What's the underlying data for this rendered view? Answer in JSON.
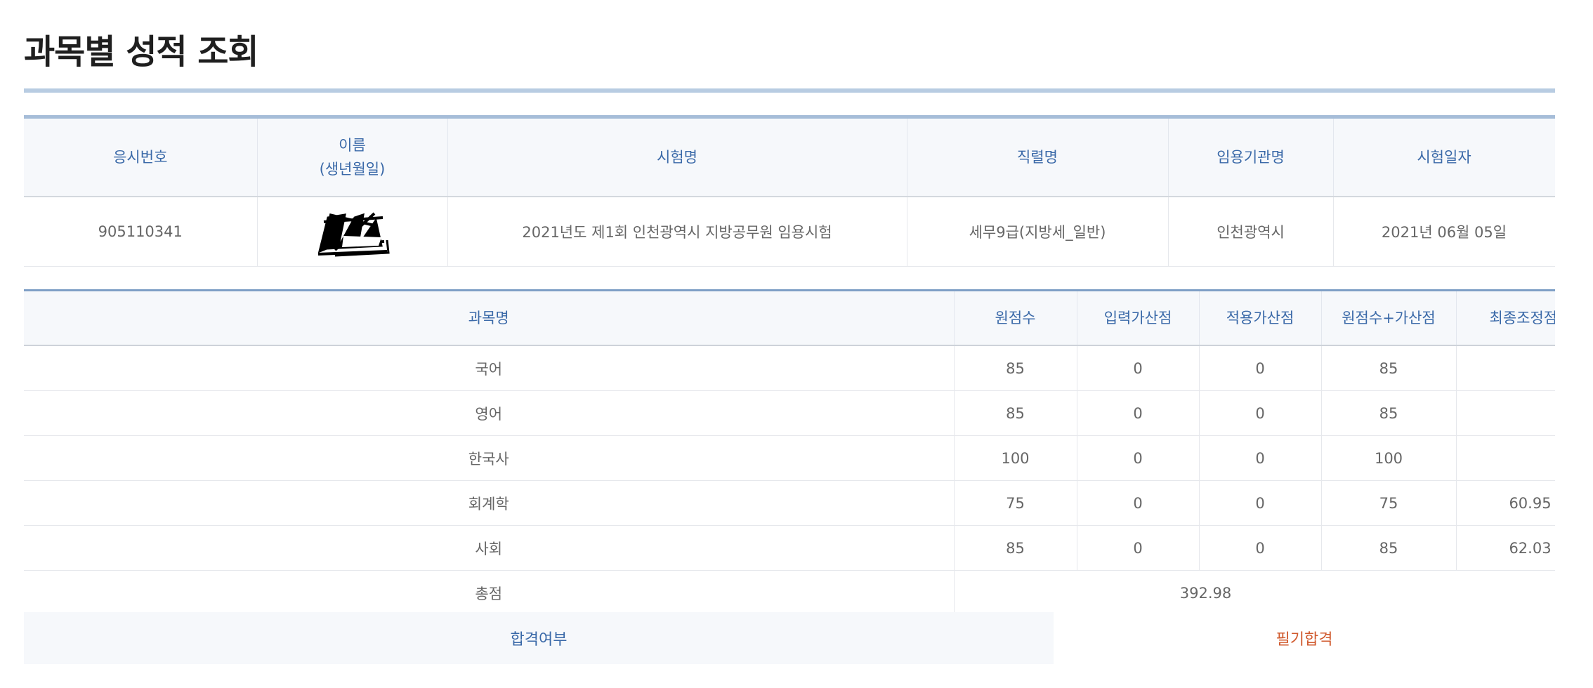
{
  "page_title": "과목별 성적 조회",
  "info": {
    "headers": {
      "exam_no": "응시번호",
      "name_line1": "이름",
      "name_line2": "(생년월일)",
      "exam_name": "시험명",
      "job_series": "직렬명",
      "agency": "임용기관명",
      "exam_date": "시험일자"
    },
    "row": {
      "exam_no": "905110341",
      "exam_name": "2021년도 제1회 인천광역시 지방공무원 임용시험",
      "job_series": "세무9급(지방세_일반)",
      "agency": "인천광역시",
      "exam_date": "2021년 06월 05일"
    }
  },
  "scores": {
    "headers": {
      "subject": "과목명",
      "raw": "원점수",
      "input_bonus": "입력가산점",
      "applied_bonus": "적용가산점",
      "raw_plus_bonus": "원점수+가산점",
      "final_adjusted": "최종조정점수"
    },
    "rows": [
      {
        "subject": "국어",
        "raw": "85",
        "input_bonus": "0",
        "applied_bonus": "0",
        "raw_plus_bonus": "85",
        "final_adjusted": ""
      },
      {
        "subject": "영어",
        "raw": "85",
        "input_bonus": "0",
        "applied_bonus": "0",
        "raw_plus_bonus": "85",
        "final_adjusted": ""
      },
      {
        "subject": "한국사",
        "raw": "100",
        "input_bonus": "0",
        "applied_bonus": "0",
        "raw_plus_bonus": "100",
        "final_adjusted": ""
      },
      {
        "subject": "회계학",
        "raw": "75",
        "input_bonus": "0",
        "applied_bonus": "0",
        "raw_plus_bonus": "75",
        "final_adjusted": "60.95"
      },
      {
        "subject": "사회",
        "raw": "85",
        "input_bonus": "0",
        "applied_bonus": "0",
        "raw_plus_bonus": "85",
        "final_adjusted": "62.03"
      }
    ],
    "total_label": "총점",
    "total_value": "392.98"
  },
  "result": {
    "label": "합격여부",
    "value": "필기합격",
    "value_color": "#d05a2e"
  },
  "colors": {
    "header_text": "#3a69a8",
    "header_bg": "#f6f8fb",
    "accent_rule": "#b8cce2"
  }
}
